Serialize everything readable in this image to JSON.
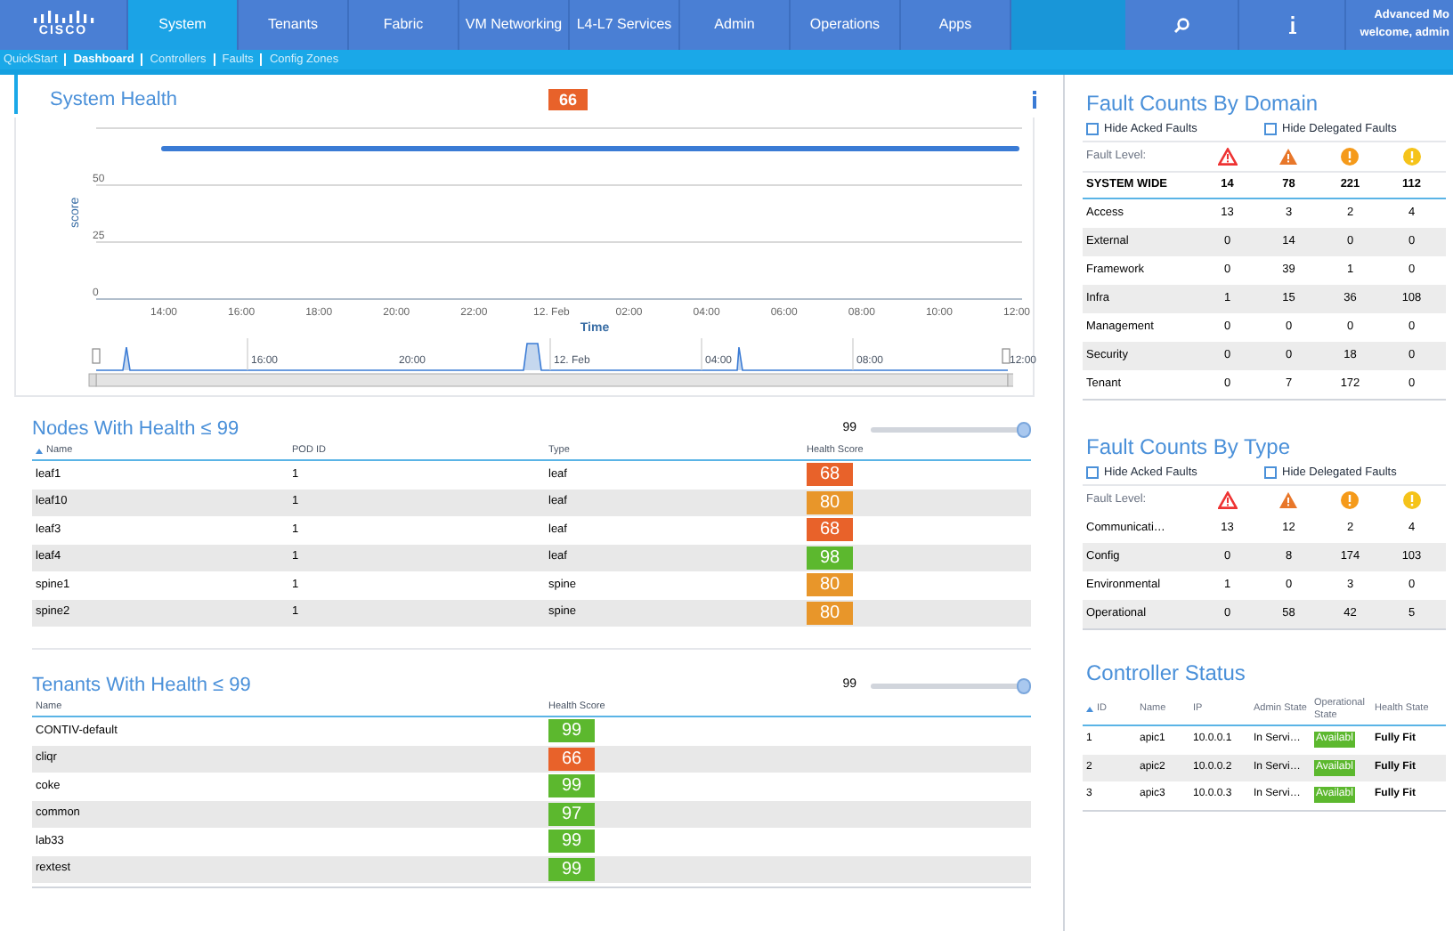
{
  "header": {
    "logo": "CISCO",
    "tabs": [
      {
        "label": "System",
        "selected": true
      },
      {
        "label": "Tenants",
        "selected": false
      },
      {
        "label": "Fabric",
        "selected": false
      },
      {
        "label": "VM Networking",
        "selected": false
      },
      {
        "label": "L4-L7 Services",
        "selected": false
      },
      {
        "label": "Admin",
        "selected": false
      },
      {
        "label": "Operations",
        "selected": false
      },
      {
        "label": "Apps",
        "selected": false
      }
    ],
    "user": {
      "mode": "Advanced Mo",
      "welcome": "welcome, admin"
    }
  },
  "subnav": [
    {
      "label": "QuickStart",
      "selected": false
    },
    {
      "label": "Dashboard",
      "selected": true
    },
    {
      "label": "Controllers",
      "selected": false
    },
    {
      "label": "Faults",
      "selected": false
    },
    {
      "label": "Config Zones",
      "selected": false
    }
  ],
  "system_health": {
    "title": "System Health",
    "score": {
      "value": "66",
      "color": "#e8622a"
    },
    "chart_data": {
      "type": "line",
      "xlabel": "Time",
      "ylabel": "score",
      "categories": [
        "14:00",
        "16:00",
        "18:00",
        "20:00",
        "22:00",
        "12. Feb",
        "02:00",
        "04:00",
        "06:00",
        "08:00",
        "10:00",
        "12:00"
      ],
      "series": [
        {
          "color": "#3a7bd5",
          "values": [
            66,
            66,
            66,
            66,
            66,
            66,
            66,
            66,
            66,
            66,
            66,
            66
          ]
        }
      ],
      "ylim": [
        0,
        75
      ],
      "yticks": [
        0,
        25,
        50
      ]
    },
    "navigator_labels": [
      "16:00",
      "20:00",
      "12. Feb",
      "04:00",
      "08:00",
      "12:00"
    ]
  },
  "nodes": {
    "title": "Nodes With Health ≤ 99",
    "slider": {
      "reading": "99",
      "level": 1
    },
    "columns": [
      "Name",
      "POD ID",
      "Type",
      "Health Score"
    ],
    "rows": [
      {
        "name": "leaf1",
        "pod": "1",
        "type": "leaf",
        "score": "68",
        "color": "#e8622a"
      },
      {
        "name": "leaf10",
        "pod": "1",
        "type": "leaf",
        "score": "80",
        "color": "#e8962a"
      },
      {
        "name": "leaf3",
        "pod": "1",
        "type": "leaf",
        "score": "68",
        "color": "#e8622a"
      },
      {
        "name": "leaf4",
        "pod": "1",
        "type": "leaf",
        "score": "98",
        "color": "#5cb82e"
      },
      {
        "name": "spine1",
        "pod": "1",
        "type": "spine",
        "score": "80",
        "color": "#e8962a"
      },
      {
        "name": "spine2",
        "pod": "1",
        "type": "spine",
        "score": "80",
        "color": "#e8962a"
      }
    ]
  },
  "tenants": {
    "title": "Tenants With Health ≤ 99",
    "slider": {
      "reading": "99",
      "level": 1
    },
    "columns": [
      "Name",
      "Health Score"
    ],
    "rows": [
      {
        "name": "CONTIV-default",
        "score": "99",
        "color": "#5cb82e"
      },
      {
        "name": "cliqr",
        "score": "66",
        "color": "#e8622a"
      },
      {
        "name": "coke",
        "score": "99",
        "color": "#5cb82e"
      },
      {
        "name": "common",
        "score": "97",
        "color": "#5cb82e"
      },
      {
        "name": "lab33",
        "score": "99",
        "color": "#5cb82e"
      },
      {
        "name": "rextest",
        "score": "99",
        "color": "#5cb82e"
      }
    ]
  },
  "faults_by_domain": {
    "title": "Fault Counts By Domain",
    "filters": [
      {
        "label": "Hide Acked Faults",
        "checked": false
      },
      {
        "label": "Hide Delegated Faults",
        "checked": false
      }
    ],
    "level_label": "Fault Level:",
    "levels": [
      {
        "kind": "critical"
      },
      {
        "kind": "major"
      },
      {
        "kind": "minor"
      },
      {
        "kind": "warning"
      }
    ],
    "summary": {
      "label": "SYSTEM WIDE",
      "counts": [
        "14",
        "78",
        "221",
        "112"
      ]
    },
    "rows": [
      {
        "label": "Access",
        "counts": [
          "13",
          "3",
          "2",
          "4"
        ]
      },
      {
        "label": "External",
        "counts": [
          "0",
          "14",
          "0",
          "0"
        ]
      },
      {
        "label": "Framework",
        "counts": [
          "0",
          "39",
          "1",
          "0"
        ]
      },
      {
        "label": "Infra",
        "counts": [
          "1",
          "15",
          "36",
          "108"
        ]
      },
      {
        "label": "Management",
        "counts": [
          "0",
          "0",
          "0",
          "0"
        ]
      },
      {
        "label": "Security",
        "counts": [
          "0",
          "0",
          "18",
          "0"
        ]
      },
      {
        "label": "Tenant",
        "counts": [
          "0",
          "7",
          "172",
          "0"
        ]
      }
    ]
  },
  "faults_by_type": {
    "title": "Fault Counts By Type",
    "filters": [
      {
        "label": "Hide Acked Faults",
        "checked": false
      },
      {
        "label": "Hide Delegated Faults",
        "checked": false
      }
    ],
    "level_label": "Fault Level:",
    "levels": [
      {
        "kind": "critical"
      },
      {
        "kind": "major"
      },
      {
        "kind": "minor"
      },
      {
        "kind": "warning"
      }
    ],
    "rows": [
      {
        "label": "Communicati…",
        "counts": [
          "13",
          "12",
          "2",
          "4"
        ]
      },
      {
        "label": "Config",
        "counts": [
          "0",
          "8",
          "174",
          "103"
        ]
      },
      {
        "label": "Environmental",
        "counts": [
          "1",
          "0",
          "3",
          "0"
        ]
      },
      {
        "label": "Operational",
        "counts": [
          "0",
          "58",
          "42",
          "5"
        ]
      }
    ]
  },
  "controllers": {
    "title": "Controller Status",
    "columns": [
      "ID",
      "Name",
      "IP",
      "Admin State",
      "Operational State",
      "Health State"
    ],
    "rows": [
      {
        "id": "1",
        "name": "apic1",
        "ip": "10.0.0.1",
        "admin": "In Servi…",
        "operational": "Availabl",
        "health": "Fully Fit"
      },
      {
        "id": "2",
        "name": "apic2",
        "ip": "10.0.0.2",
        "admin": "In Servi…",
        "operational": "Availabl",
        "health": "Fully Fit"
      },
      {
        "id": "3",
        "name": "apic3",
        "ip": "10.0.0.3",
        "admin": "In Servi…",
        "operational": "Availabl",
        "health": "Fully Fit"
      }
    ]
  }
}
